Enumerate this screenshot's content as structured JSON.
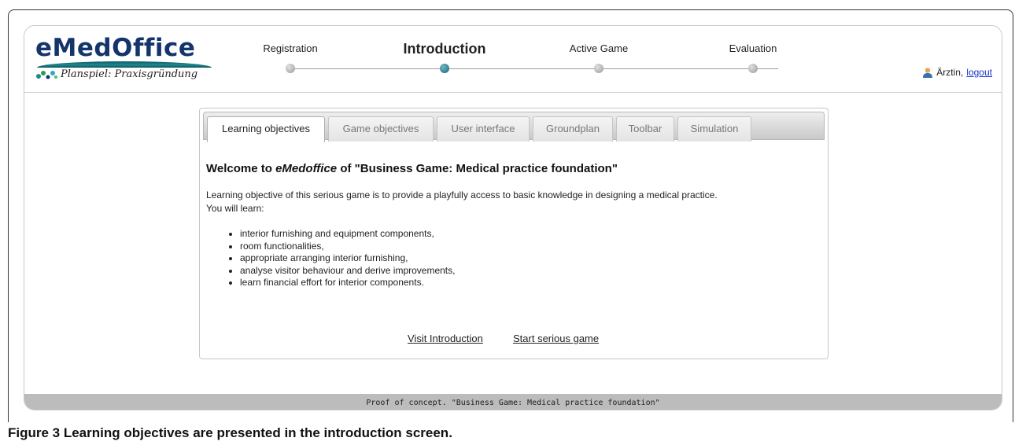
{
  "header": {
    "logo_title": "eMedOffice",
    "logo_subtitle": "Planspiel: Praxisgründung",
    "steps": [
      {
        "label": "Registration",
        "active": false
      },
      {
        "label": "Introduction",
        "active": true
      },
      {
        "label": "Active Game",
        "active": false
      },
      {
        "label": "Evaluation",
        "active": false
      }
    ],
    "user_name": "Ärztin,",
    "logout_label": "logout"
  },
  "tabs": [
    {
      "label": "Learning objectives",
      "active": true
    },
    {
      "label": "Game objectives",
      "active": false
    },
    {
      "label": "User interface",
      "active": false
    },
    {
      "label": "Groundplan",
      "active": false
    },
    {
      "label": "Toolbar",
      "active": false
    },
    {
      "label": "Simulation",
      "active": false
    }
  ],
  "content": {
    "welcome_prefix": "Welcome to ",
    "welcome_product": "eMedoffice",
    "welcome_suffix": " of \"Business Game: Medical practice foundation\"",
    "intro_line1": "Learning objective of this serious game is to provide a playfully access to basic knowledge in designing a medical practice.",
    "intro_line2": "You will learn:",
    "objectives": [
      "interior furnishing and equipment components,",
      "room functionalities,",
      "appropriate arranging interior furnishing,",
      "analyse visitor behaviour and derive improvements,",
      "learn financial effort for interior components."
    ],
    "visit_intro_label": "Visit Introduction",
    "start_game_label": "Start serious game"
  },
  "footer": {
    "text": "Proof of concept. \"Business Game: Medical practice foundation\""
  },
  "caption": {
    "label": "Figure 3",
    "text": " Learning objectives are presented in the introduction screen."
  },
  "colors": {
    "logo_blue": "#14356b",
    "active_step": "#17657a",
    "link_blue": "#1a33cc",
    "footer_gray": "#bcbcbc"
  }
}
